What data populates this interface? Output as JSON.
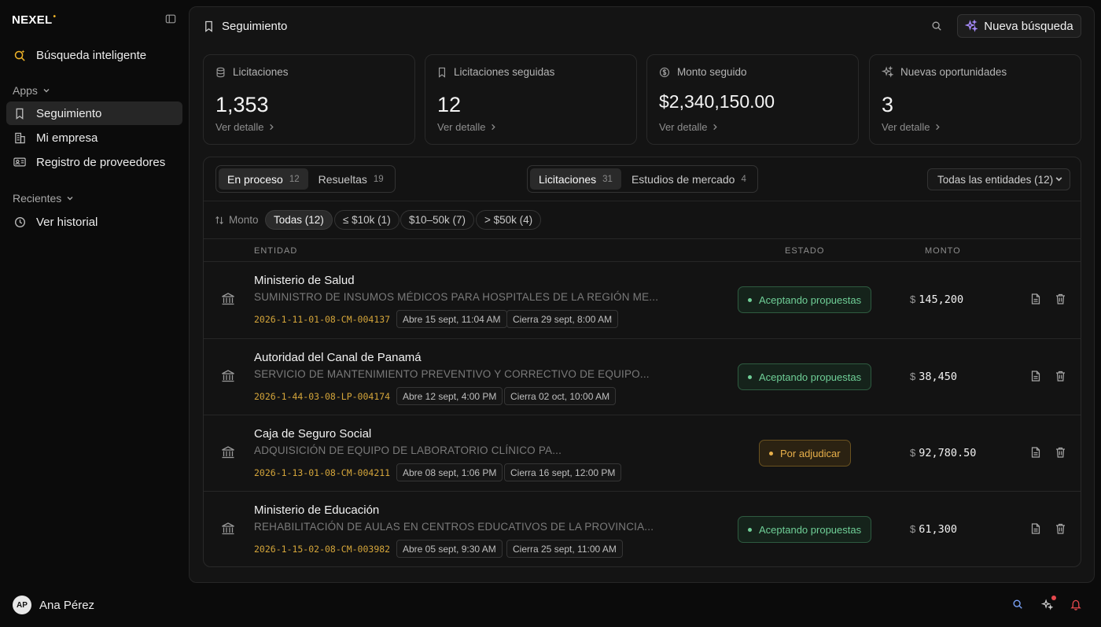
{
  "app": {
    "logo": "NEXEL",
    "logo_mark": "•"
  },
  "sidebar": {
    "smart_search": "Búsqueda inteligente",
    "apps_label": "Apps",
    "items": [
      {
        "label": "Seguimiento",
        "icon": "bookmark-icon",
        "active": true
      },
      {
        "label": "Mi empresa",
        "icon": "building-icon",
        "active": false
      },
      {
        "label": "Registro de proveedores",
        "icon": "id-card-icon",
        "active": false
      }
    ],
    "recent_label": "Recientes",
    "history": "Ver historial",
    "user": {
      "initials": "AP",
      "name": "Ana Pérez"
    }
  },
  "header": {
    "title": "Seguimiento",
    "new_search": "Nueva búsqueda"
  },
  "cards": [
    {
      "label": "Licitaciones",
      "value": "1,353",
      "link": "Ver detalle"
    },
    {
      "label": "Licitaciones seguidas",
      "value": "12",
      "link": "Ver detalle"
    },
    {
      "label": "Monto seguido",
      "value": "$2,340,150.00",
      "link": "Ver detalle"
    },
    {
      "label": "Nuevas oportunidades",
      "value": "3",
      "link": "Ver detalle"
    }
  ],
  "tabs_status": [
    {
      "label": "En proceso",
      "count": "12"
    },
    {
      "label": "Resueltas",
      "count": "19"
    }
  ],
  "tabs_type": [
    {
      "label": "Licitaciones",
      "count": "31"
    },
    {
      "label": "Estudios de mercado",
      "count": "4"
    }
  ],
  "entity_filter": "Todas las entidades (12)",
  "amount_filter": {
    "label": "Monto",
    "chips": [
      "Todas (12)",
      "≤ $10k (1)",
      "$10–50k (7)",
      "> $50k (4)"
    ]
  },
  "columns": {
    "entity": "ENTIDAD",
    "status": "ESTADO",
    "amount": "MONTO"
  },
  "rows": [
    {
      "entity": "Ministerio de Salud",
      "description": "SUMINISTRO DE INSUMOS MÉDICOS PARA HOSPITALES DE LA REGIÓN ME...",
      "code": "2026-1-11-01-08-CM-004137",
      "opens": "Abre 15 sept, 11:04 AM",
      "closes": "Cierra 29 sept, 8:00 AM",
      "status": "Aceptando propuestas",
      "currency": "$",
      "amount": "145,200"
    },
    {
      "entity": "Autoridad del Canal de Panamá",
      "description": "SERVICIO DE MANTENIMIENTO PREVENTIVO Y CORRECTIVO DE EQUIPO...",
      "code": "2026-1-44-03-08-LP-004174",
      "opens": "Abre 12 sept, 4:00 PM",
      "closes": "Cierra 02 oct, 10:00 AM",
      "status": "Aceptando propuestas",
      "currency": "$",
      "amount": "38,450"
    },
    {
      "entity": "Caja de Seguro Social",
      "description": "ADQUISICIÓN DE EQUIPO DE LABORATORIO CLÍNICO PA...",
      "code": "2026-1-13-01-08-CM-004211",
      "opens": "Abre 08 sept, 1:06 PM",
      "closes": "Cierra 16 sept, 12:00 PM",
      "status": "Por adjudicar",
      "currency": "$",
      "amount": "92,780.50"
    },
    {
      "entity": "Ministerio de Educación",
      "description": "REHABILITACIÓN DE AULAS EN CENTROS EDUCATIVOS DE LA PROVINCIA...",
      "code": "2026-1-15-02-08-CM-003982",
      "opens": "Abre 05 sept, 9:30 AM",
      "closes": "Cierra 25 sept, 11:00 AM",
      "status": "Aceptando propuestas",
      "currency": "$",
      "amount": "61,300"
    }
  ],
  "colors": {
    "accent": "#f0b429",
    "status_green": "#6fcf97",
    "status_amber": "#e8b04a",
    "sparkle": "#a78bfa"
  }
}
